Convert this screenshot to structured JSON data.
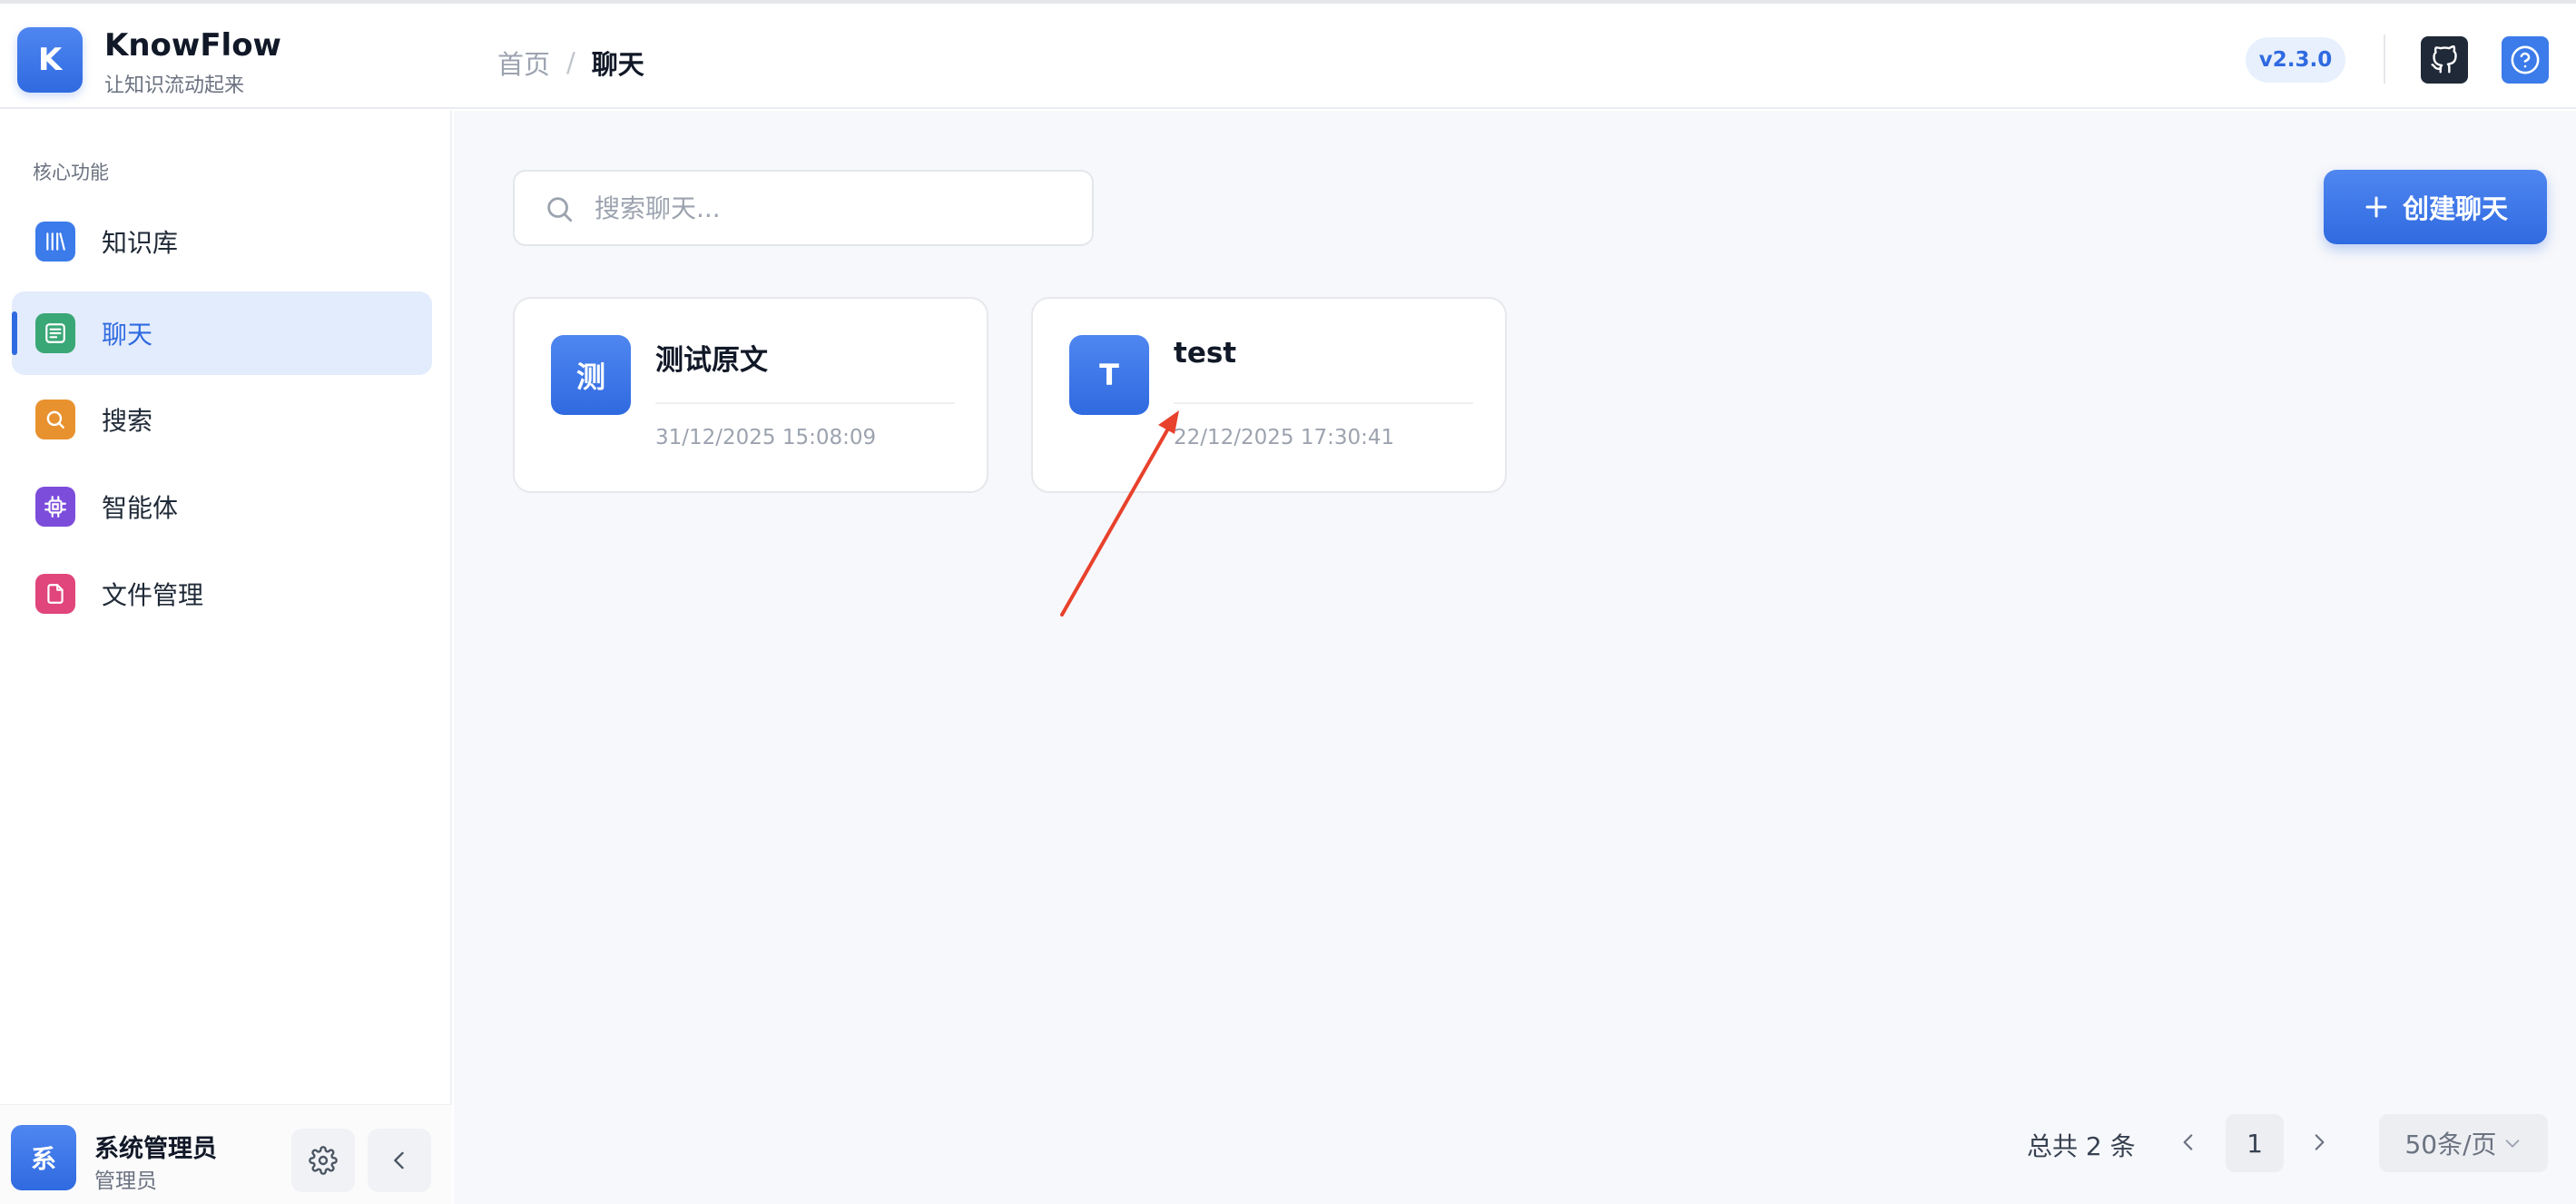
{
  "app": {
    "logo_letter": "K",
    "name": "KnowFlow",
    "subtitle": "让知识流动起来",
    "version": "v2.3.0"
  },
  "breadcrumb": {
    "home": "首页",
    "separator": "/",
    "current": "聊天"
  },
  "sidebar": {
    "section_title": "核心功能",
    "items": [
      {
        "label": "知识库",
        "icon": "library-icon",
        "color": "#3b7bea",
        "active": false
      },
      {
        "label": "聊天",
        "icon": "chat-icon",
        "color": "#3aa776",
        "active": true
      },
      {
        "label": "搜索",
        "icon": "search-icon",
        "color": "#e8922f",
        "active": false
      },
      {
        "label": "智能体",
        "icon": "chip-icon",
        "color": "#7c4ddb",
        "active": false
      },
      {
        "label": "文件管理",
        "icon": "file-icon",
        "color": "#e0457b",
        "active": false
      }
    ],
    "user": {
      "avatar_letter": "系",
      "name": "系统管理员",
      "role": "管理员"
    }
  },
  "main": {
    "search": {
      "placeholder": "搜索聊天...",
      "value": ""
    },
    "create_button": "创建聊天",
    "cards": [
      {
        "avatar": "测",
        "title": "测试原文",
        "time": "31/12/2025 15:08:09"
      },
      {
        "avatar": "T",
        "title": "test",
        "time": "22/12/2025 17:30:41"
      }
    ],
    "pagination": {
      "total": "总共 2 条",
      "current_page": "1",
      "page_size": "50条/页"
    }
  },
  "colors": {
    "accent": "#2f6ae0",
    "annotation_arrow": "#e8412c"
  }
}
